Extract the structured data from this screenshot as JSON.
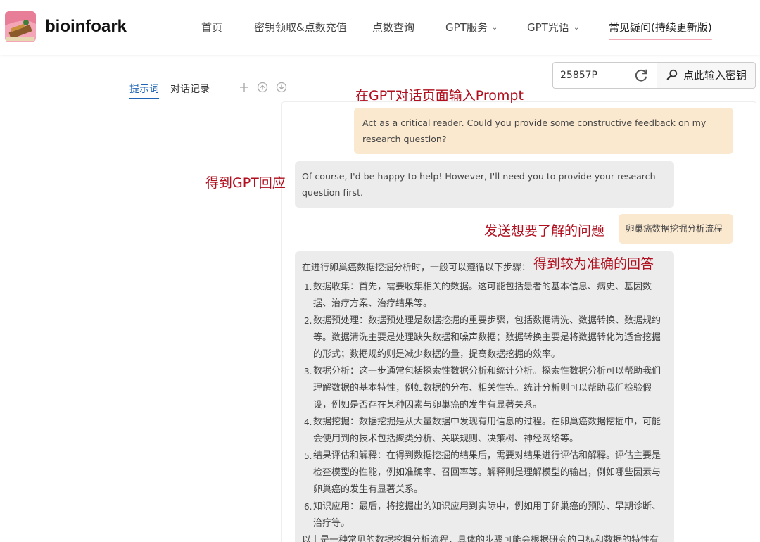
{
  "header": {
    "brand": "bioinfoark",
    "nav": [
      {
        "label": "首页",
        "has_dropdown": false
      },
      {
        "label": "密钥领取&点数充值",
        "has_dropdown": false
      },
      {
        "label": "点数查询",
        "has_dropdown": false
      },
      {
        "label": "GPT服务",
        "has_dropdown": true
      },
      {
        "label": "GPT咒语",
        "has_dropdown": true
      },
      {
        "label": "常见疑问(持续更新版)",
        "has_dropdown": false,
        "active": true
      }
    ],
    "accent_color": "#f3a9b5"
  },
  "key": {
    "value": "25857P",
    "button_label": "点此输入密钥",
    "refresh_icon": "refresh-icon",
    "search_icon": "search-icon"
  },
  "tabs": [
    {
      "label": "提示词",
      "active": true
    },
    {
      "label": "对话记录",
      "active": false
    }
  ],
  "tools": [
    "plus-icon",
    "arrow-up-circle-icon",
    "arrow-down-circle-icon"
  ],
  "annotations": {
    "prompt_input": "在GPT对话页面输入Prompt",
    "gpt_reply": "得到GPT回应",
    "send_question": "发送想要了解的问题",
    "accurate_answer": "得到较为准确的回答",
    "color": "#b10e1e"
  },
  "messages": {
    "user_1": "Act as a critical reader. Could you provide some constructive feedback on my research question?",
    "bot_1": "Of course, I'd be happy to help! However, I'll need you to provide your research question first.",
    "user_2": "卵巢癌数据挖掘分析流程"
  },
  "answer": {
    "intro": "在进行卵巢癌数据挖掘分析时，一般可以遵循以下步骤：",
    "steps": [
      {
        "num": "1.",
        "text": "数据收集：首先，需要收集相关的数据。这可能包括患者的基本信息、病史、基因数据、治疗方案、治疗结果等。"
      },
      {
        "num": "2.",
        "text": "数据预处理：数据预处理是数据挖掘的重要步骤，包括数据清洗、数据转换、数据规约等。数据清洗主要是处理缺失数据和噪声数据；数据转换主要是将数据转化为适合挖掘的形式；数据规约则是减少数据的量，提高数据挖掘的效率。"
      },
      {
        "num": "3.",
        "text": "数据分析：这一步通常包括探索性数据分析和统计分析。探索性数据分析可以帮助我们理解数据的基本特性，例如数据的分布、相关性等。统计分析则可以帮助我们检验假设，例如是否存在某种因素与卵巢癌的发生有显著关系。"
      },
      {
        "num": "4.",
        "text": "数据挖掘：数据挖掘是从大量数据中发现有用信息的过程。在卵巢癌数据挖掘中，可能会使用到的技术包括聚类分析、关联规则、决策树、神经网络等。"
      },
      {
        "num": "5.",
        "text": "结果评估和解释：在得到数据挖掘的结果后，需要对结果进行评估和解释。评估主要是检查模型的性能，例如准确率、召回率等。解释则是理解模型的输出，例如哪些因素与卵巢癌的发生有显著关系。"
      },
      {
        "num": "6.",
        "text": "知识应用：最后，将挖掘出的知识应用到实际中，例如用于卵巢癌的预防、早期诊断、治疗等。"
      }
    ],
    "outro": "以上是一种常见的数据挖掘分析流程，具体的步骤可能会根据研究的目标和数据的特性有"
  }
}
